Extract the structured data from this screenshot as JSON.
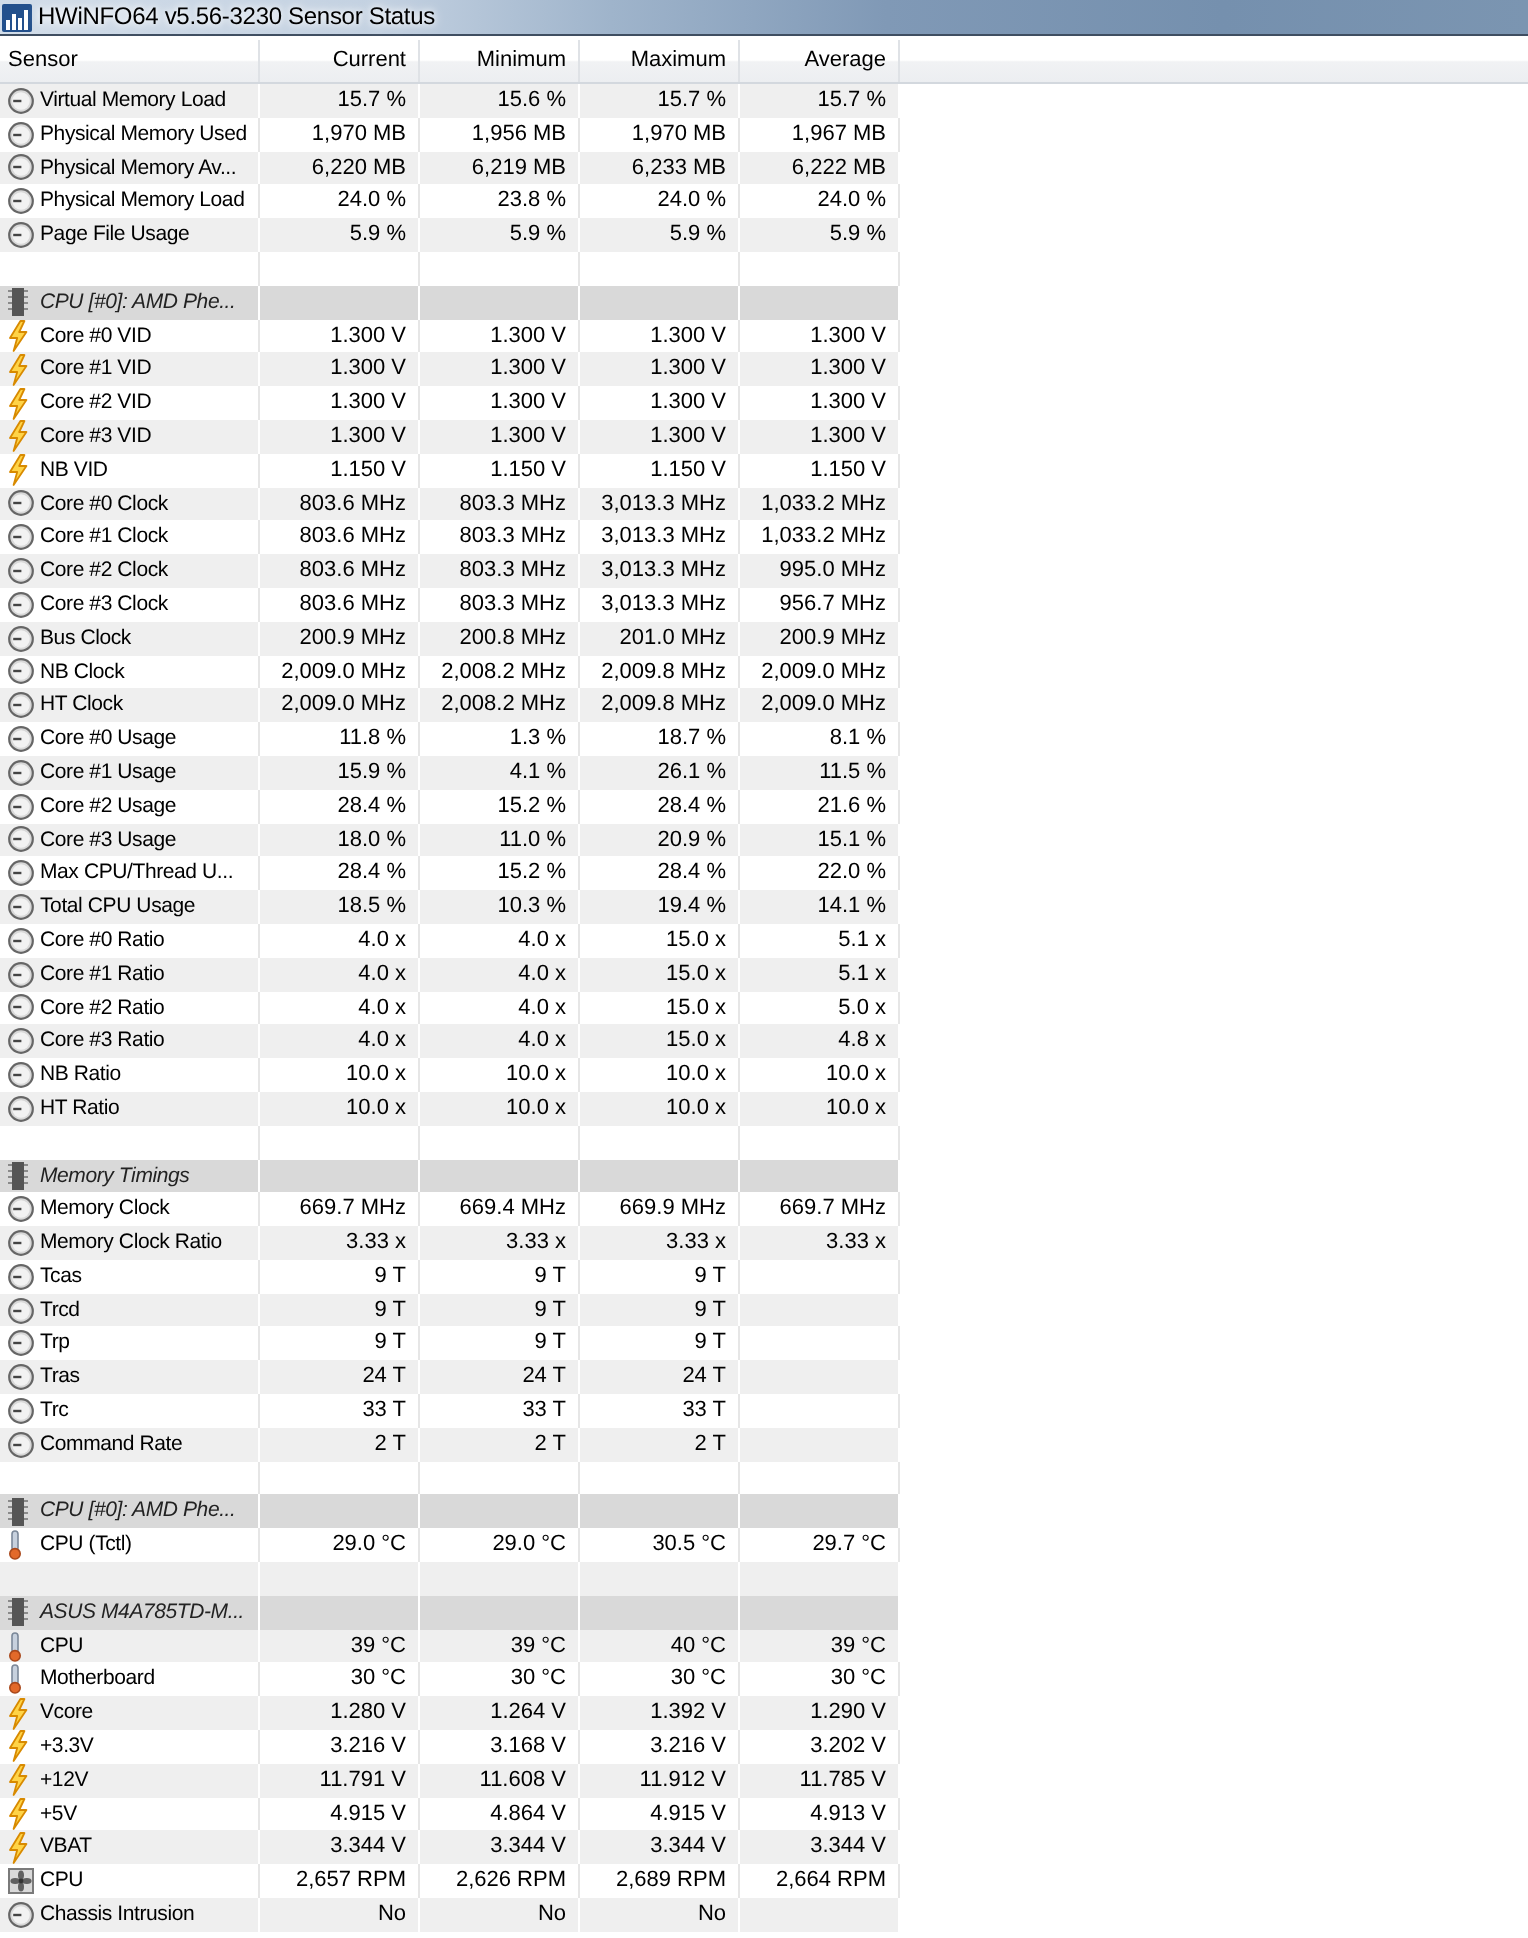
{
  "window": {
    "title": "HWiNFO64 v5.56-3230 Sensor Status"
  },
  "table": {
    "columns": [
      "Sensor",
      "Current",
      "Minimum",
      "Maximum",
      "Average"
    ],
    "sections": [
      {
        "rows": [
          {
            "kind": "general",
            "sensor": "Virtual Memory Load",
            "values": [
              "15.7 %",
              "15.6 %",
              "15.7 %",
              "15.7 %"
            ]
          },
          {
            "kind": "general",
            "sensor": "Physical Memory Used",
            "values": [
              "1,970 MB",
              "1,956 MB",
              "1,970 MB",
              "1,967 MB"
            ]
          },
          {
            "kind": "general",
            "sensor": "Physical Memory Av...",
            "values": [
              "6,220 MB",
              "6,219 MB",
              "6,233 MB",
              "6,222 MB"
            ]
          },
          {
            "kind": "general",
            "sensor": "Physical Memory Load",
            "values": [
              "24.0 %",
              "23.8 %",
              "24.0 %",
              "24.0 %"
            ]
          },
          {
            "kind": "general",
            "sensor": "Page File Usage",
            "values": [
              "5.9 %",
              "5.9 %",
              "5.9 %",
              "5.9 %"
            ]
          }
        ]
      },
      {
        "title": "CPU [#0]: AMD Phe...",
        "rows": [
          {
            "kind": "voltage",
            "sensor": "Core #0 VID",
            "values": [
              "1.300 V",
              "1.300 V",
              "1.300 V",
              "1.300 V"
            ]
          },
          {
            "kind": "voltage",
            "sensor": "Core #1 VID",
            "values": [
              "1.300 V",
              "1.300 V",
              "1.300 V",
              "1.300 V"
            ]
          },
          {
            "kind": "voltage",
            "sensor": "Core #2 VID",
            "values": [
              "1.300 V",
              "1.300 V",
              "1.300 V",
              "1.300 V"
            ]
          },
          {
            "kind": "voltage",
            "sensor": "Core #3 VID",
            "values": [
              "1.300 V",
              "1.300 V",
              "1.300 V",
              "1.300 V"
            ]
          },
          {
            "kind": "voltage",
            "sensor": "NB VID",
            "values": [
              "1.150 V",
              "1.150 V",
              "1.150 V",
              "1.150 V"
            ]
          },
          {
            "kind": "general",
            "sensor": "Core #0 Clock",
            "values": [
              "803.6 MHz",
              "803.3 MHz",
              "3,013.3 MHz",
              "1,033.2 MHz"
            ]
          },
          {
            "kind": "general",
            "sensor": "Core #1 Clock",
            "values": [
              "803.6 MHz",
              "803.3 MHz",
              "3,013.3 MHz",
              "1,033.2 MHz"
            ]
          },
          {
            "kind": "general",
            "sensor": "Core #2 Clock",
            "values": [
              "803.6 MHz",
              "803.3 MHz",
              "3,013.3 MHz",
              "995.0 MHz"
            ]
          },
          {
            "kind": "general",
            "sensor": "Core #3 Clock",
            "values": [
              "803.6 MHz",
              "803.3 MHz",
              "3,013.3 MHz",
              "956.7 MHz"
            ]
          },
          {
            "kind": "general",
            "sensor": "Bus Clock",
            "values": [
              "200.9 MHz",
              "200.8 MHz",
              "201.0 MHz",
              "200.9 MHz"
            ]
          },
          {
            "kind": "general",
            "sensor": "NB Clock",
            "values": [
              "2,009.0 MHz",
              "2,008.2 MHz",
              "2,009.8 MHz",
              "2,009.0 MHz"
            ]
          },
          {
            "kind": "general",
            "sensor": "HT Clock",
            "values": [
              "2,009.0 MHz",
              "2,008.2 MHz",
              "2,009.8 MHz",
              "2,009.0 MHz"
            ]
          },
          {
            "kind": "general",
            "sensor": "Core #0 Usage",
            "values": [
              "11.8 %",
              "1.3 %",
              "18.7 %",
              "8.1 %"
            ]
          },
          {
            "kind": "general",
            "sensor": "Core #1 Usage",
            "values": [
              "15.9 %",
              "4.1 %",
              "26.1 %",
              "11.5 %"
            ]
          },
          {
            "kind": "general",
            "sensor": "Core #2 Usage",
            "values": [
              "28.4 %",
              "15.2 %",
              "28.4 %",
              "21.6 %"
            ]
          },
          {
            "kind": "general",
            "sensor": "Core #3 Usage",
            "values": [
              "18.0 %",
              "11.0 %",
              "20.9 %",
              "15.1 %"
            ]
          },
          {
            "kind": "general",
            "sensor": "Max CPU/Thread U...",
            "values": [
              "28.4 %",
              "15.2 %",
              "28.4 %",
              "22.0 %"
            ]
          },
          {
            "kind": "general",
            "sensor": "Total CPU Usage",
            "values": [
              "18.5 %",
              "10.3 %",
              "19.4 %",
              "14.1 %"
            ]
          },
          {
            "kind": "general",
            "sensor": "Core #0 Ratio",
            "values": [
              "4.0 x",
              "4.0 x",
              "15.0 x",
              "5.1 x"
            ]
          },
          {
            "kind": "general",
            "sensor": "Core #1 Ratio",
            "values": [
              "4.0 x",
              "4.0 x",
              "15.0 x",
              "5.1 x"
            ]
          },
          {
            "kind": "general",
            "sensor": "Core #2 Ratio",
            "values": [
              "4.0 x",
              "4.0 x",
              "15.0 x",
              "5.0 x"
            ]
          },
          {
            "kind": "general",
            "sensor": "Core #3 Ratio",
            "values": [
              "4.0 x",
              "4.0 x",
              "15.0 x",
              "4.8 x"
            ]
          },
          {
            "kind": "general",
            "sensor": "NB Ratio",
            "values": [
              "10.0 x",
              "10.0 x",
              "10.0 x",
              "10.0 x"
            ]
          },
          {
            "kind": "general",
            "sensor": "HT Ratio",
            "values": [
              "10.0 x",
              "10.0 x",
              "10.0 x",
              "10.0 x"
            ]
          }
        ]
      },
      {
        "title": "Memory Timings",
        "rows": [
          {
            "kind": "general",
            "sensor": "Memory Clock",
            "values": [
              "669.7 MHz",
              "669.4 MHz",
              "669.9 MHz",
              "669.7 MHz"
            ]
          },
          {
            "kind": "general",
            "sensor": "Memory Clock Ratio",
            "values": [
              "3.33 x",
              "3.33 x",
              "3.33 x",
              "3.33 x"
            ]
          },
          {
            "kind": "general",
            "sensor": "Tcas",
            "values": [
              "9 T",
              "9 T",
              "9 T"
            ]
          },
          {
            "kind": "general",
            "sensor": "Trcd",
            "values": [
              "9 T",
              "9 T",
              "9 T"
            ]
          },
          {
            "kind": "general",
            "sensor": "Trp",
            "values": [
              "9 T",
              "9 T",
              "9 T"
            ]
          },
          {
            "kind": "general",
            "sensor": "Tras",
            "values": [
              "24 T",
              "24 T",
              "24 T"
            ]
          },
          {
            "kind": "general",
            "sensor": "Trc",
            "values": [
              "33 T",
              "33 T",
              "33 T"
            ]
          },
          {
            "kind": "general",
            "sensor": "Command Rate",
            "values": [
              "2 T",
              "2 T",
              "2 T"
            ]
          }
        ]
      },
      {
        "title": "CPU [#0]: AMD Phe...",
        "rows": [
          {
            "kind": "temperature",
            "sensor": "CPU (Tctl)",
            "values": [
              "29.0 °C",
              "29.0 °C",
              "30.5 °C",
              "29.7 °C"
            ]
          }
        ]
      },
      {
        "title": "ASUS M4A785TD-M...",
        "rows": [
          {
            "kind": "temperature",
            "sensor": "CPU",
            "values": [
              "39 °C",
              "39 °C",
              "40 °C",
              "39 °C"
            ]
          },
          {
            "kind": "temperature",
            "sensor": "Motherboard",
            "values": [
              "30 °C",
              "30 °C",
              "30 °C",
              "30 °C"
            ]
          },
          {
            "kind": "voltage",
            "sensor": "Vcore",
            "values": [
              "1.280 V",
              "1.264 V",
              "1.392 V",
              "1.290 V"
            ]
          },
          {
            "kind": "voltage",
            "sensor": "+3.3V",
            "values": [
              "3.216 V",
              "3.168 V",
              "3.216 V",
              "3.202 V"
            ]
          },
          {
            "kind": "voltage",
            "sensor": "+12V",
            "values": [
              "11.791 V",
              "11.608 V",
              "11.912 V",
              "11.785 V"
            ]
          },
          {
            "kind": "voltage",
            "sensor": "+5V",
            "values": [
              "4.915 V",
              "4.864 V",
              "4.915 V",
              "4.913 V"
            ]
          },
          {
            "kind": "voltage",
            "sensor": "VBAT",
            "values": [
              "3.344 V",
              "3.344 V",
              "3.344 V",
              "3.344 V"
            ]
          },
          {
            "kind": "fan",
            "sensor": "CPU",
            "values": [
              "2,657 RPM",
              "2,626 RPM",
              "2,689 RPM",
              "2,664 RPM"
            ]
          },
          {
            "kind": "general",
            "sensor": "Chassis Intrusion",
            "values": [
              "No",
              "No",
              "No"
            ]
          }
        ]
      }
    ]
  }
}
